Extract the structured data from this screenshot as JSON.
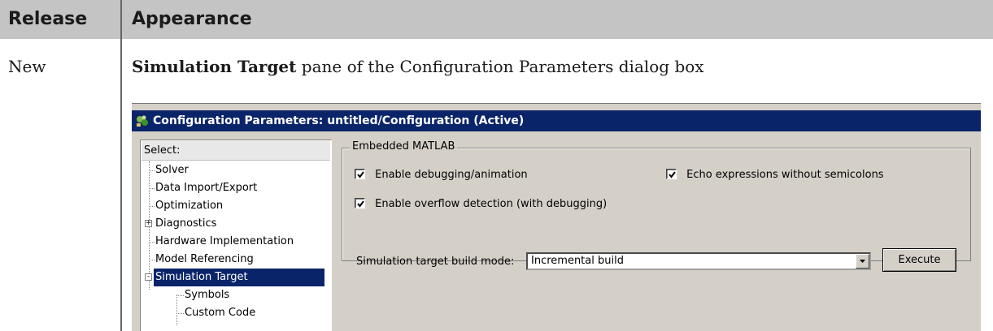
{
  "table": {
    "header": {
      "release": "Release",
      "appearance": "Appearance"
    },
    "row": {
      "release": "New",
      "caption_bold": "Simulation Target",
      "caption_rest": " pane of the Configuration Parameters dialog box"
    }
  },
  "dialog": {
    "title": "Configuration Parameters: untitled/Configuration (Active)",
    "colors": {
      "titlebar": "#0a246a",
      "face": "#d4d0c8",
      "selection": "#0a246a"
    },
    "tree": {
      "header": "Select:",
      "items": [
        {
          "label": "Solver"
        },
        {
          "label": "Data Import/Export"
        },
        {
          "label": "Optimization"
        },
        {
          "label": "Diagnostics",
          "expander": "+"
        },
        {
          "label": "Hardware Implementation"
        },
        {
          "label": "Model Referencing"
        },
        {
          "label": "Simulation Target",
          "expander": "-",
          "selected": true
        },
        {
          "label": "Symbols"
        },
        {
          "label": "Custom Code"
        }
      ]
    },
    "group": {
      "title": "Embedded MATLAB",
      "checkboxes": [
        {
          "label": "Enable debugging/animation",
          "checked": true
        },
        {
          "label": "Echo expressions without semicolons",
          "checked": true
        },
        {
          "label": "Enable overflow detection (with debugging)",
          "checked": true
        }
      ],
      "build_mode": {
        "label": "Simulation target build mode:",
        "value": "Incremental build"
      },
      "execute_label": "Execute"
    }
  }
}
